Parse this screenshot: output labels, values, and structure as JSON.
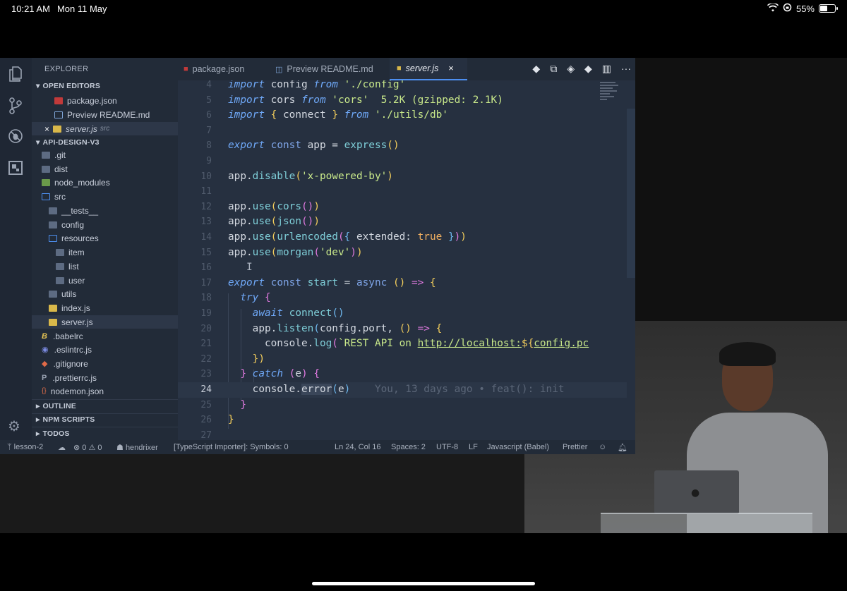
{
  "device_status": {
    "time": "10:21 AM",
    "date": "Mon 11 May",
    "battery": "55%",
    "battery_level": 0.55
  },
  "explorer": {
    "title": "EXPLORER",
    "open_editors_label": "OPEN EDITORS",
    "open_editors": [
      {
        "name": "package.json",
        "icon": "npm-icon"
      },
      {
        "name": "Preview README.md",
        "icon": "preview-icon"
      },
      {
        "name": "server.js",
        "suffix": "src",
        "icon": "js-icon",
        "close": "×"
      }
    ],
    "project_label": "API-DESIGN-V3",
    "tree": [
      {
        "name": ".git"
      },
      {
        "name": "dist"
      },
      {
        "name": "node_modules"
      },
      {
        "name": "src"
      },
      {
        "name": "__tests__"
      },
      {
        "name": "config"
      },
      {
        "name": "resources"
      },
      {
        "name": "item"
      },
      {
        "name": "list"
      },
      {
        "name": "user"
      },
      {
        "name": "utils"
      },
      {
        "name": "index.js"
      },
      {
        "name": "server.js"
      },
      {
        "name": ".babelrc"
      },
      {
        "name": ".eslintrc.js"
      },
      {
        "name": ".gitignore"
      },
      {
        "name": ".prettierrc.js"
      },
      {
        "name": "nodemon.json"
      }
    ],
    "outline_label": "OUTLINE",
    "npm_scripts_label": "NPM SCRIPTS",
    "todos_label": "TODOS"
  },
  "tabs": [
    {
      "label": "package.json"
    },
    {
      "label": "Preview README.md"
    },
    {
      "label": "server.js",
      "close": "×"
    }
  ],
  "code": {
    "line_numbers": [
      "4",
      "5",
      "6",
      "7",
      "8",
      "9",
      "10",
      "11",
      "12",
      "13",
      "14",
      "15",
      "16",
      "17",
      "18",
      "19",
      "20",
      "21",
      "22",
      "23",
      "24",
      "25",
      "26",
      "27"
    ],
    "import_size_hint": "5.2K (gzipped: 2.1K)",
    "blame": "You, 13 days ago • feat(): init"
  },
  "statusbar": {
    "branch": "lesson-2",
    "errors": "0",
    "warnings": "0",
    "user": "hendrixer",
    "ts_importer": "[TypeScript Importer]: Symbols: 0",
    "cursor": "Ln 24, Col 16",
    "spaces": "Spaces: 2",
    "encoding": "UTF-8",
    "eol": "LF",
    "language": "Javascript (Babel)",
    "formatter": "Prettier"
  },
  "colors": {
    "editor_bg": "#263040",
    "sidebar_bg": "#222b38",
    "accent": "#4d8ff0",
    "keyword": "#6fa8f7",
    "string": "#c8e88a"
  }
}
